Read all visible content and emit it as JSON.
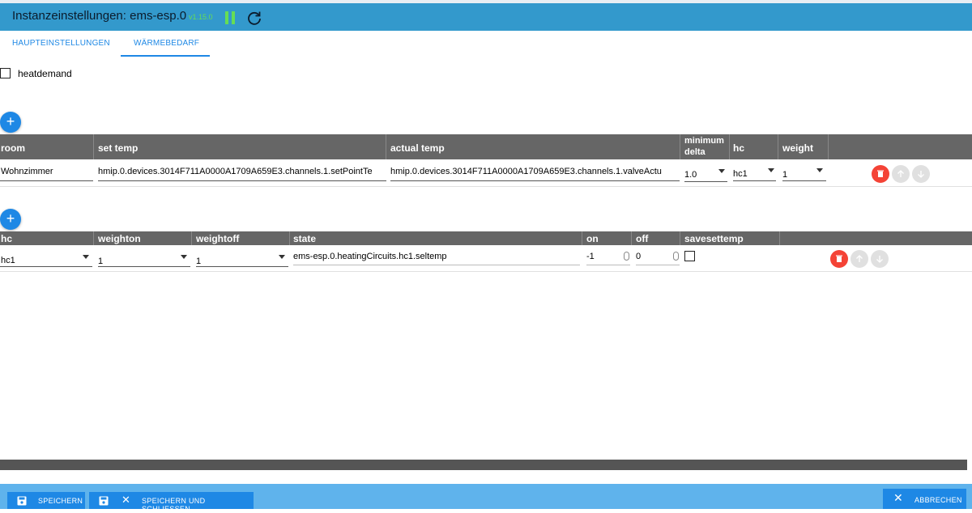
{
  "header": {
    "title": "Instanzeinstellungen: ems-esp.0",
    "version": "v1.15.0",
    "pause_icon": "pause-icon",
    "reload_icon": "reload-icon"
  },
  "tabs": [
    {
      "label": "HAUPTEINSTELLUNGEN",
      "active": false
    },
    {
      "label": "WÄRMEBEDARF",
      "active": true
    }
  ],
  "heatdemand": {
    "label": "heatdemand",
    "checked": false
  },
  "rooms_table": {
    "add_icon": "+",
    "headers": {
      "room": "room",
      "set_temp": "set temp",
      "actual_temp": "actual temp",
      "minimum_delta_1": "minimum",
      "minimum_delta_2": "delta",
      "hc": "hc",
      "weight": "weight"
    },
    "rows": [
      {
        "room": "Wohnzimmer",
        "set_temp": "hmip.0.devices.3014F711A0000A1709A659E3.channels.1.setPointTe",
        "actual_temp": "hmip.0.devices.3014F711A0000A1709A659E3.channels.1.valveActu",
        "minimum_delta": "1.0",
        "hc": "hc1",
        "weight": "1"
      }
    ]
  },
  "hc_table": {
    "add_icon": "+",
    "headers": {
      "hc": "hc",
      "weighton": "weighton",
      "weightoff": "weightoff",
      "state": "state",
      "on": "on",
      "off": "off",
      "savesettemp": "savesettemp"
    },
    "rows": [
      {
        "hc": "hc1",
        "weighton": "1",
        "weightoff": "1",
        "state": "ems-esp.0.heatingCircuits.hc1.seltemp",
        "on": "-1",
        "off": "0",
        "savesettemp": false
      }
    ]
  },
  "footer": {
    "save_label": "SPEICHERN",
    "save_close_label": "SPEICHERN UND SCHLIESSEN",
    "cancel_label": "ABBRECHEN",
    "close_glyph": "✕"
  },
  "colors": {
    "header_bg": "#3399cc",
    "accent": "#1e88e5",
    "version_green": "#66dd55",
    "delete_red": "#f44336",
    "table_header_bg": "#666666",
    "footer_bg": "#5fb3ec"
  }
}
